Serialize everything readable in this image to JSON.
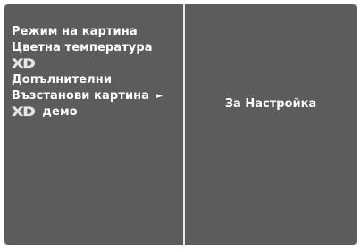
{
  "menu": {
    "items": [
      {
        "label": "Режим на картина"
      },
      {
        "label": "Цветна температура"
      },
      {
        "logo": "XD"
      },
      {
        "label": "Допълнителни"
      },
      {
        "label": "Възстанови картина",
        "arrow": "►"
      },
      {
        "logo": "XD",
        "label": "демо"
      }
    ]
  },
  "submenu": {
    "value": "За Настройка"
  }
}
